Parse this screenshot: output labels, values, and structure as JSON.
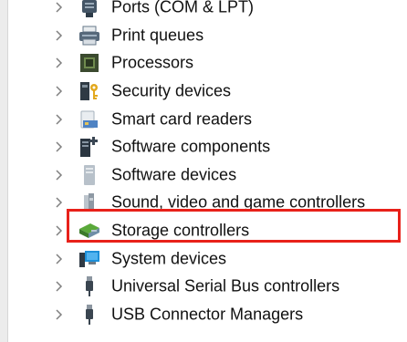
{
  "device_tree": {
    "items": [
      {
        "label": "Ports (COM & LPT)",
        "icon": "port-icon"
      },
      {
        "label": "Print queues",
        "icon": "printer-icon"
      },
      {
        "label": "Processors",
        "icon": "processor-icon"
      },
      {
        "label": "Security devices",
        "icon": "security-key-icon"
      },
      {
        "label": "Smart card readers",
        "icon": "smart-card-reader-icon"
      },
      {
        "label": "Software components",
        "icon": "software-component-icon"
      },
      {
        "label": "Software devices",
        "icon": "software-device-icon"
      },
      {
        "label": "Sound, video and game controllers",
        "icon": "speaker-icon",
        "highlighted": true
      },
      {
        "label": "Storage controllers",
        "icon": "storage-controller-icon"
      },
      {
        "label": "System devices",
        "icon": "system-device-icon"
      },
      {
        "label": "Universal Serial Bus controllers",
        "icon": "usb-icon"
      },
      {
        "label": "USB Connector Managers",
        "icon": "usb-icon"
      }
    ]
  },
  "colors": {
    "highlight_border": "#e8211a",
    "text": "#111111",
    "chevron": "#808080"
  }
}
